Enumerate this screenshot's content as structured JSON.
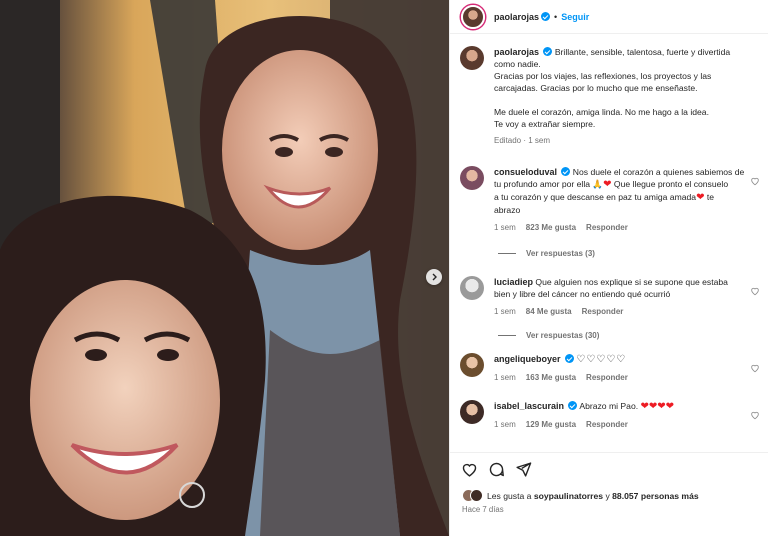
{
  "post": {
    "author": "paolarojas",
    "follow_label": "Seguir",
    "caption_lines": [
      "Brillante, sensible, talentosa, fuerte y divertida",
      "como nadie.",
      "Gracias por los viajes, las reflexiones, los proyectos y las",
      "carcajadas. Gracias por lo mucho que me enseñaste.",
      "",
      "Me duele el corazón, amiga linda. No me hago a la idea.",
      "Te voy a extrañar siempre."
    ],
    "caption_meta": "Editado · 1 sem"
  },
  "comments": [
    {
      "user": "consueloduval",
      "verified": true,
      "text_lines": [
        "Nos duele el corazón a quienes sabiemos de",
        "tu profundo amor por ella",
        "Que llegue pronto el consuelo",
        "a tu corazón y que descanse en paz tu amiga amada",
        "te",
        "abrazo"
      ],
      "time": "1 sem",
      "likes": "823 Me gusta",
      "reply": "Responder",
      "view_replies": "Ver respuestas (3)"
    },
    {
      "user": "luciadiep",
      "verified": false,
      "text_lines": [
        "Que alguien nos explique si se supone que estaba",
        "bien y libre del cáncer no entiendo qué ocurrió"
      ],
      "time": "1 sem",
      "likes": "84 Me gusta",
      "reply": "Responder",
      "view_replies": "Ver respuestas (30)"
    },
    {
      "user": "angeliqueboyer",
      "verified": true,
      "hearts": "♡♡♡♡♡",
      "time": "1 sem",
      "likes": "163 Me gusta",
      "reply": "Responder"
    },
    {
      "user": "isabel_lascurain",
      "verified": true,
      "text": "Abrazo mi Pao.",
      "hearts": "❤❤❤❤",
      "time": "1 sem",
      "likes": "129 Me gusta",
      "reply": "Responder"
    }
  ],
  "footer": {
    "likes_prefix": "Les gusta a",
    "likes_user": "soypaulinatorres",
    "likes_suffix": "y",
    "likes_count": "88.057 personas más",
    "time": "Hace 7 días"
  },
  "icons": {
    "like": "heart-icon",
    "comment": "comment-icon",
    "share": "paper-plane-icon",
    "next": "chevron-right-icon",
    "verified": "verified-badge-icon"
  },
  "colors": {
    "accent": "#0095f6",
    "heart": "#ed1c24",
    "muted": "#737373"
  }
}
